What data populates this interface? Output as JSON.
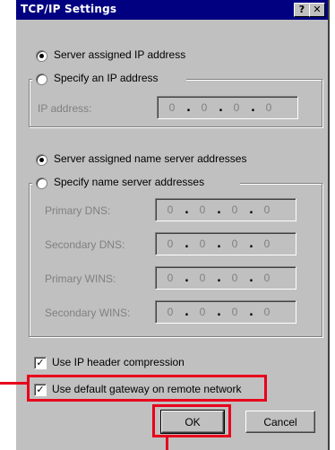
{
  "window": {
    "title": "TCP/IP Settings",
    "help_label": "?",
    "close_label": "✕"
  },
  "ip_section": {
    "server_assigned_label": "Server assigned IP address",
    "specify_label": "Specify an IP address",
    "ip_address_label": "IP address:",
    "ip_octets": [
      "0",
      "0",
      "0",
      "0"
    ]
  },
  "dns_section": {
    "server_assigned_label": "Server assigned name server addresses",
    "specify_label": "Specify name server addresses",
    "primary_dns_label": "Primary DNS:",
    "secondary_dns_label": "Secondary DNS:",
    "primary_wins_label": "Primary WINS:",
    "secondary_wins_label": "Secondary WINS:",
    "primary_dns_octets": [
      "0",
      "0",
      "0",
      "0"
    ],
    "secondary_dns_octets": [
      "0",
      "0",
      "0",
      "0"
    ],
    "primary_wins_octets": [
      "0",
      "0",
      "0",
      "0"
    ],
    "secondary_wins_octets": [
      "0",
      "0",
      "0",
      "0"
    ]
  },
  "options": {
    "ip_header_compression_label": "Use IP header compression",
    "ip_header_compression_checked": true,
    "default_gateway_label": "Use default gateway on remote network",
    "default_gateway_checked": true,
    "check_mark": "✓"
  },
  "buttons": {
    "ok_label": "OK",
    "cancel_label": "Cancel"
  },
  "colors": {
    "highlight": "#e8001c",
    "titlebar": "#000080",
    "face": "#c0c0c0"
  }
}
